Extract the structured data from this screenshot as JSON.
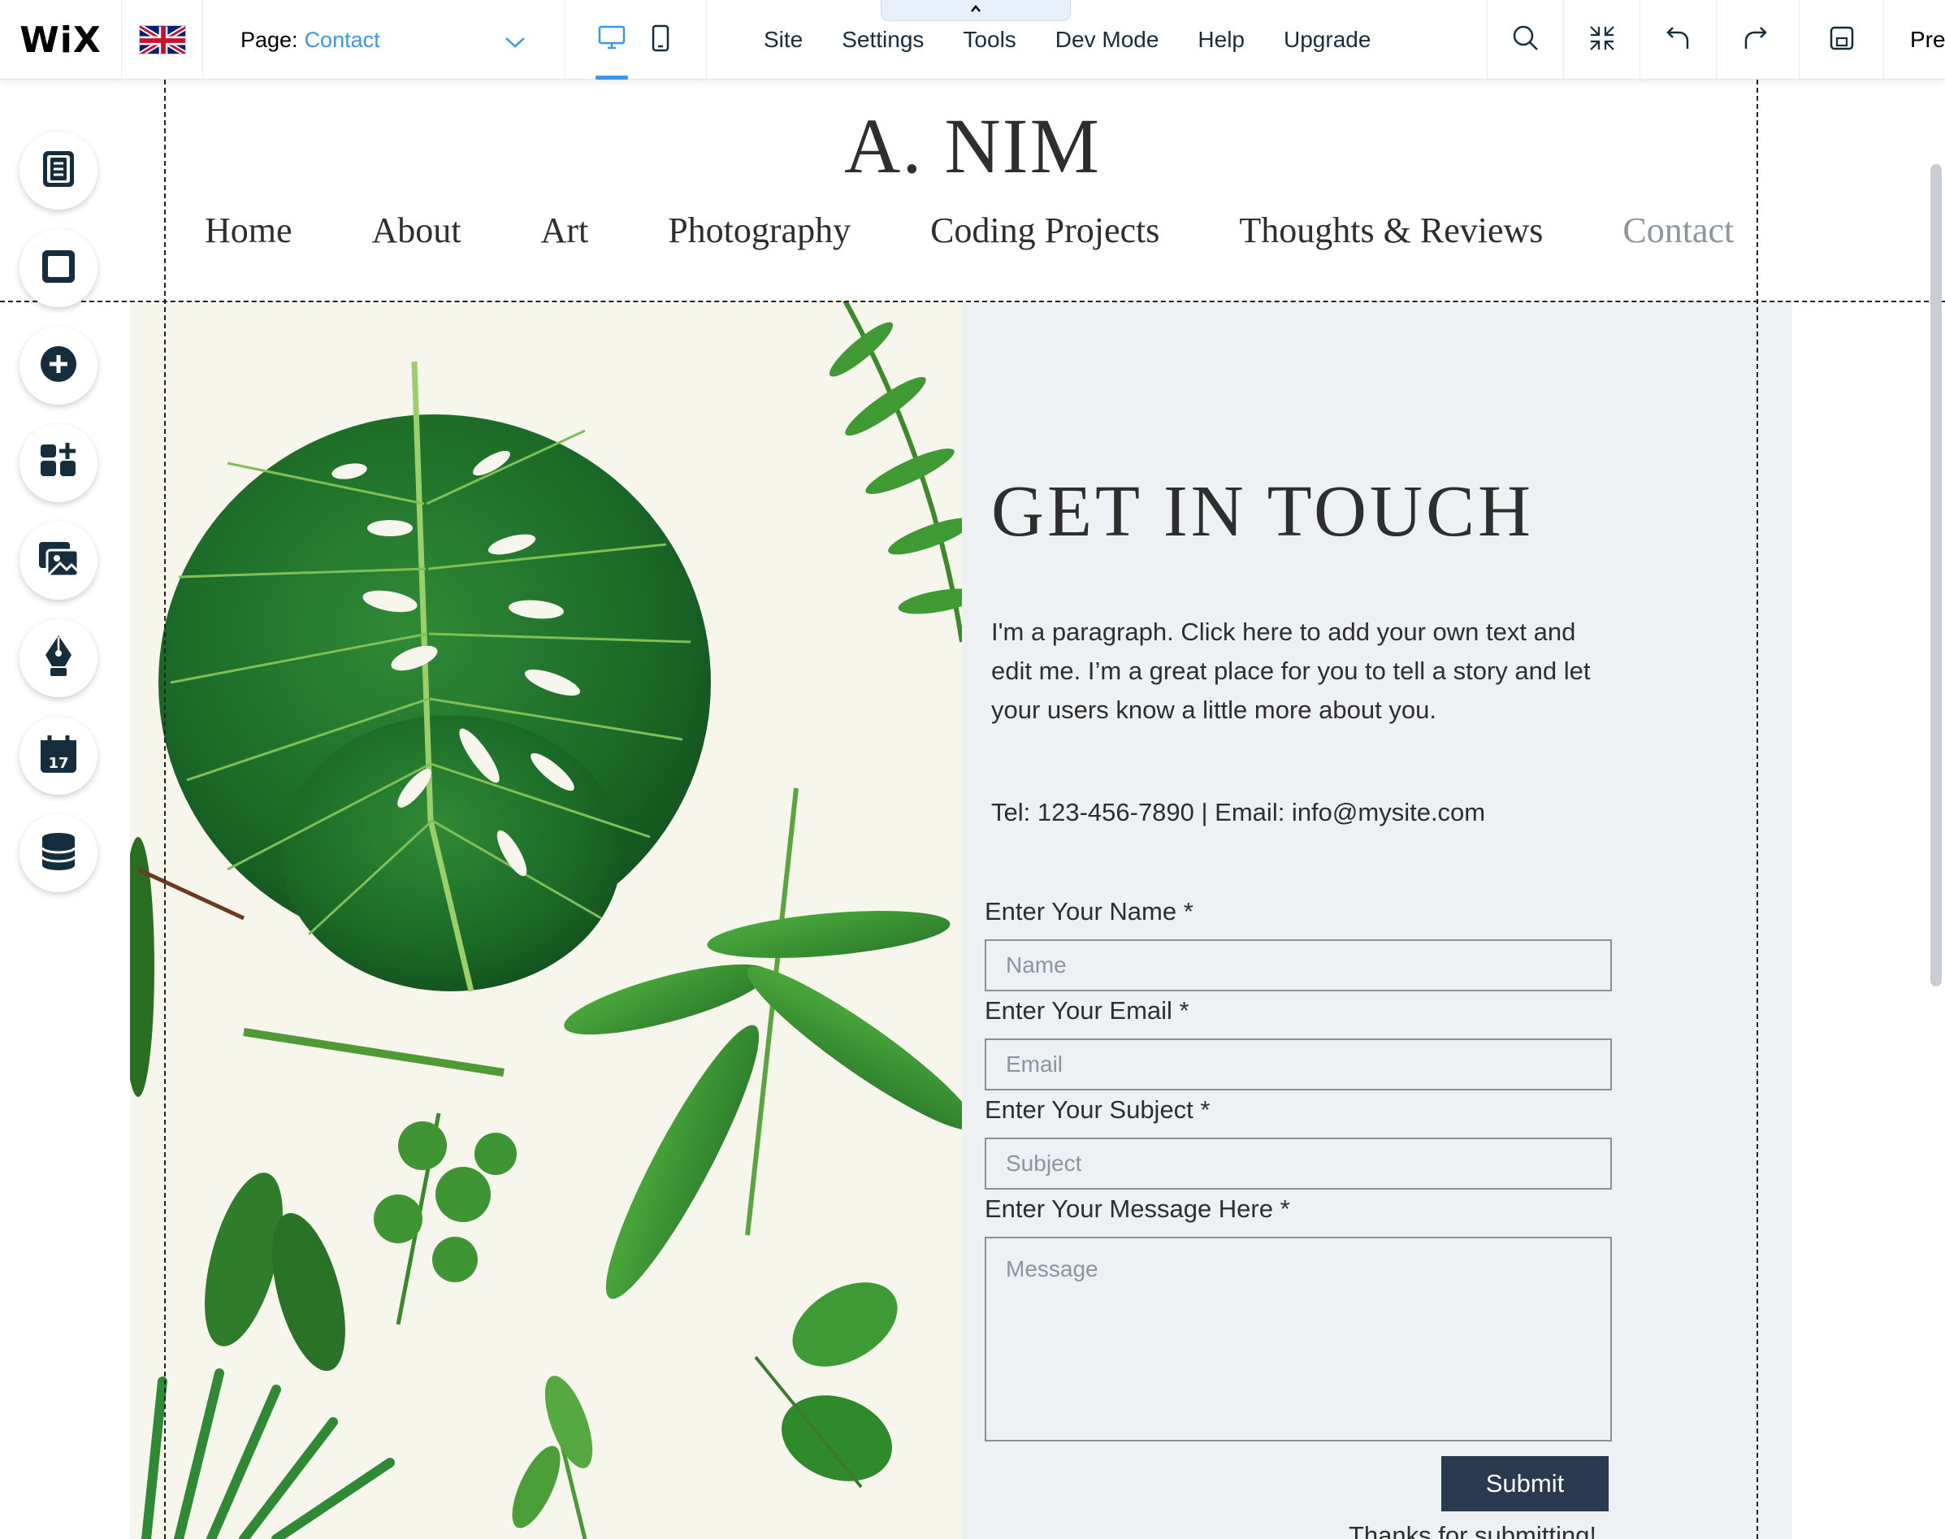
{
  "editor": {
    "logo": "WiX",
    "page_selector": {
      "label": "Page:",
      "value": "Contact"
    },
    "menu": [
      "Site",
      "Settings",
      "Tools",
      "Dev Mode",
      "Help",
      "Upgrade"
    ],
    "preview_label": "Pre",
    "toolbar_icons": [
      "search-icon",
      "zoom-out-icon",
      "undo-icon",
      "redo-icon",
      "save-icon"
    ],
    "device_icons": [
      "desktop-icon",
      "mobile-icon"
    ],
    "active_device": "desktop",
    "rail_icons": [
      "pages-icon",
      "background-icon",
      "add-icon",
      "add-apps-icon",
      "media-icon",
      "blog-icon",
      "bookings-icon",
      "database-icon"
    ],
    "accent_color": "#3899ec"
  },
  "site": {
    "title": "A. NIM",
    "nav": [
      "Home",
      "About",
      "Art",
      "Photography",
      "Coding Projects",
      "Thoughts & Reviews",
      "Contact"
    ],
    "current_page": "Contact"
  },
  "contact": {
    "heading": "GET IN TOUCH",
    "paragraph": "I'm a paragraph. Click here to add your own text and edit me. I’m a great place for you to tell a story and let your users know a little more about you.",
    "contact_line": "Tel: 123-456-7890  |  Email: info@mysite.com",
    "form": {
      "name_label": "Enter Your Name *",
      "name_placeholder": "Name",
      "email_label": "Enter Your Email *",
      "email_placeholder": "Email",
      "subject_label": "Enter Your Subject *",
      "subject_placeholder": "Subject",
      "message_label": "Enter Your Message Here *",
      "message_placeholder": "Message",
      "submit_label": "Submit",
      "thanks": "Thanks for submitting!"
    },
    "button_color": "#2a3a50"
  }
}
